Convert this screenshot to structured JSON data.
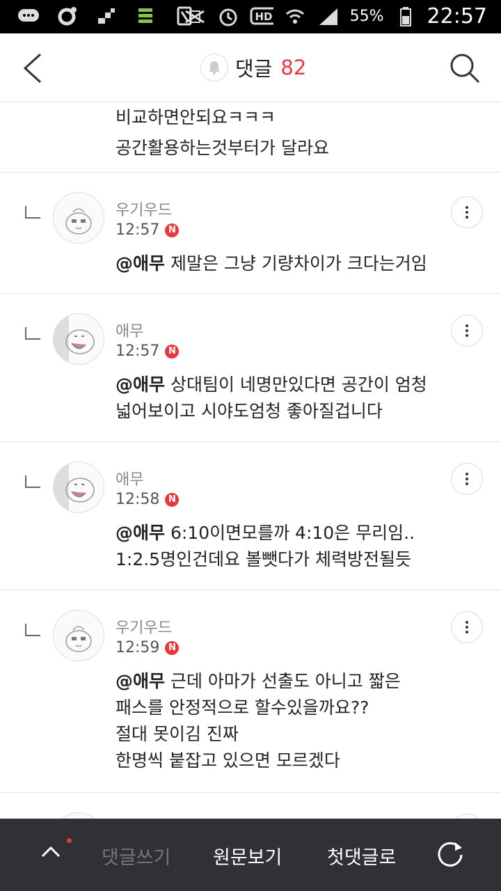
{
  "statusbar": {
    "battery": "55%",
    "time": "22:57",
    "icons": [
      "message-icon",
      "circle-icon",
      "bars-icon",
      "list-icon",
      "nfc-icon",
      "mute-icon",
      "alarm-icon",
      "hd-icon",
      "wifi-icon",
      "signal-icon",
      "battery-icon"
    ]
  },
  "header": {
    "title": "댓글",
    "count": "82",
    "icons": [
      "back-icon",
      "bell-icon",
      "search-icon"
    ]
  },
  "partial_comment": {
    "line1": "비교하면안되요ㅋㅋㅋ",
    "line2": "공간활용하는것부터가 달라요"
  },
  "comments": [
    {
      "author": "우기우드",
      "time": "12:57",
      "badge": "N",
      "mention": "@애무",
      "text": " 제말은 그냥 기량차이가 크다는거임"
    },
    {
      "author": "애무",
      "time": "12:57",
      "badge": "N",
      "mention": "@애무",
      "text": " 상대팀이 네명만있다면 공간이 엄청\n넓어보이고 시야도엄청 좋아질겁니다"
    },
    {
      "author": "애무",
      "time": "12:58",
      "badge": "N",
      "mention": "@애무",
      "text": " 6:10이면모를까 4:10은 무리임..\n1:2.5명인건데요 볼뺏다가 체력방전될듯"
    },
    {
      "author": "우기우드",
      "time": "12:59",
      "badge": "N",
      "mention": "@애무",
      "text": " 근데 아마가 선출도 아니고 짧은\n패스를 안정적으로 할수있을까요??\n절대 못이김 진짜\n한명씩 붙잡고 있으면 모르겠다"
    }
  ],
  "bottombar": {
    "write": "댓글쓰기",
    "original": "원문보기",
    "first": "첫댓글로"
  },
  "colors": {
    "accent": "#e8383d",
    "bottombar": "#2f3134"
  }
}
